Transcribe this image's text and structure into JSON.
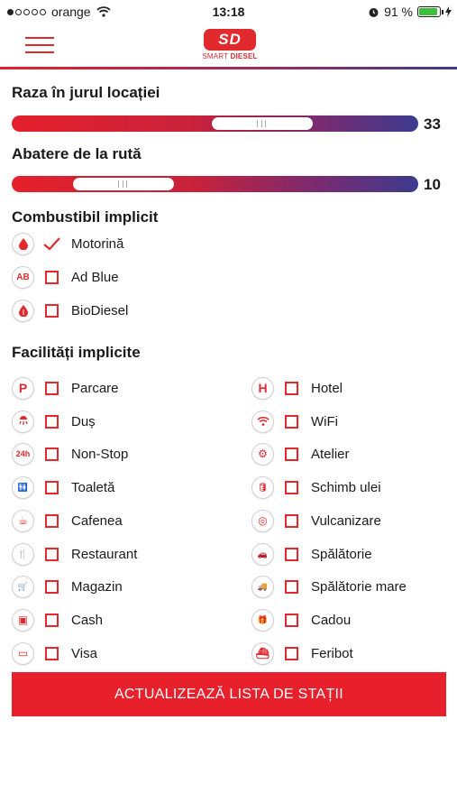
{
  "status_bar": {
    "carrier": "orange",
    "time": "13:18",
    "battery": "91 %",
    "battery_level": 0.91
  },
  "header": {
    "logo_badge": "SD",
    "logo_text_smart": "SMART",
    "logo_text_diesel": "DIESEL"
  },
  "radius": {
    "label": "Raza în jurul locației",
    "value": "33"
  },
  "deviation": {
    "label": "Abatere de la rută",
    "value": "10"
  },
  "fuel": {
    "title": "Combustibil implicit",
    "options": [
      {
        "label": "Motorină",
        "checked": true,
        "icon": "fuel-drop-icon"
      },
      {
        "label": "Ad Blue",
        "checked": false,
        "icon": "adblue-icon",
        "glyph": "AB"
      },
      {
        "label": "BioDiesel",
        "checked": false,
        "icon": "biodiesel-drop-icon"
      }
    ]
  },
  "facilities": {
    "title": "Facilități implicite",
    "left": [
      {
        "label": "Parcare",
        "icon": "parking-icon",
        "glyph": "P"
      },
      {
        "label": "Duș",
        "icon": "shower-icon"
      },
      {
        "label": "Non-Stop",
        "icon": "24h-icon",
        "glyph": "24h"
      },
      {
        "label": "Toaletă",
        "icon": "toilet-icon",
        "glyph": "🚻"
      },
      {
        "label": "Cafenea",
        "icon": "coffee-icon",
        "glyph": "☕"
      },
      {
        "label": "Restaurant",
        "icon": "restaurant-icon",
        "glyph": "🍴"
      },
      {
        "label": "Magazin",
        "icon": "cart-icon",
        "glyph": "🛒"
      },
      {
        "label": "Cash",
        "icon": "wallet-icon",
        "glyph": "▣"
      },
      {
        "label": "Visa",
        "icon": "card-icon",
        "glyph": "▭"
      }
    ],
    "right": [
      {
        "label": "Hotel",
        "icon": "hotel-icon",
        "glyph": "H"
      },
      {
        "label": "WiFi",
        "icon": "wifi-icon"
      },
      {
        "label": "Atelier",
        "icon": "workshop-icon",
        "glyph": "⚙"
      },
      {
        "label": "Schimb ulei",
        "icon": "oil-change-icon",
        "glyph": "🛢"
      },
      {
        "label": "Vulcanizare",
        "icon": "tire-icon",
        "glyph": "◎"
      },
      {
        "label": "Spălătorie",
        "icon": "car-wash-icon",
        "glyph": "🚗"
      },
      {
        "label": "Spălătorie mare",
        "icon": "truck-wash-icon",
        "glyph": "🚚"
      },
      {
        "label": "Cadou",
        "icon": "gift-icon",
        "glyph": "🎁"
      },
      {
        "label": "Feribot",
        "icon": "ferry-icon",
        "glyph": "⛴"
      }
    ]
  },
  "action_button": "ACTUALIZEAZĂ LISTA DE STAȚII",
  "colors": {
    "accent": "#e22a2e",
    "gradient_end": "#3d3a8e"
  }
}
